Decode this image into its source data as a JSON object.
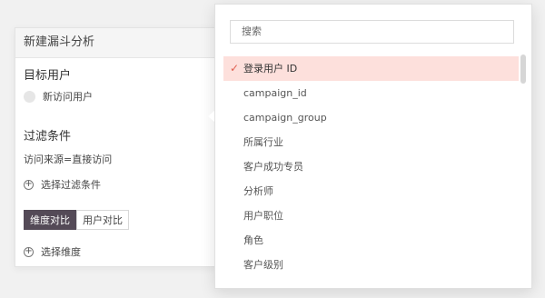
{
  "panel": {
    "title": "新建漏斗分析",
    "target_label": "目标用户",
    "user_option": "新访问用户",
    "filter_label": "过滤条件",
    "filter_value": "访问来源=直接访问",
    "add_filter": "选择过滤条件",
    "tabs": [
      "维度对比",
      "用户对比"
    ],
    "active_tab": "维度对比",
    "add_dimension": "选择维度"
  },
  "dropdown": {
    "search_placeholder": "搜索",
    "items": [
      "登录用户 ID",
      "campaign_id",
      "campaign_group",
      "所属行业",
      "客户成功专员",
      "分析师",
      "用户职位",
      "角色",
      "客户级别"
    ],
    "selected": "登录用户 ID",
    "check_mark": "✓",
    "accent_color": "#e05f4f",
    "selected_bg": "#fde0dc"
  },
  "icons": {
    "plus": "+"
  }
}
